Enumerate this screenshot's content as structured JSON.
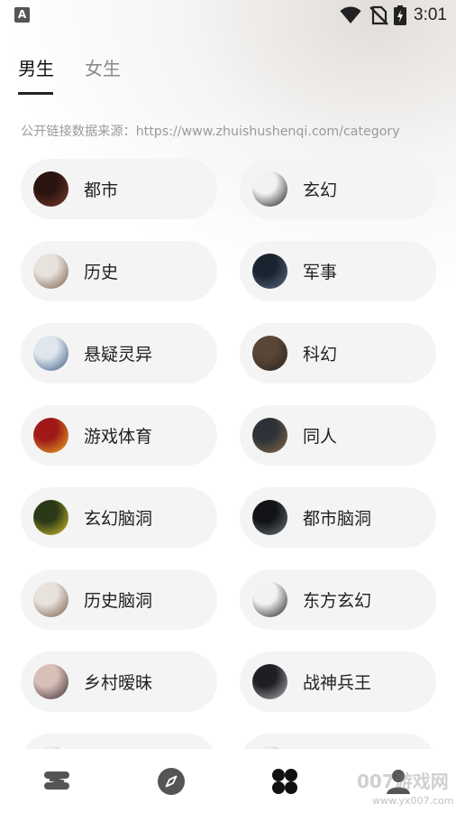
{
  "status_bar": {
    "app_icon_letter": "A",
    "time": "3:01",
    "icons": [
      "wifi-icon",
      "no-sim-icon",
      "battery-charging-icon"
    ]
  },
  "tabs": [
    {
      "label": "男生",
      "active": true
    },
    {
      "label": "女生",
      "active": false
    }
  ],
  "source_note": "公开链接数据来源：https://www.zhuishushenqi.com/category",
  "categories": [
    {
      "label": "都市",
      "cover_colors": [
        "#2a1410",
        "#7a3a2a"
      ]
    },
    {
      "label": "玄幻",
      "cover_colors": [
        "#f2f2f2",
        "#1a1a1a"
      ]
    },
    {
      "label": "历史",
      "cover_colors": [
        "#e8e2dc",
        "#7a5a44"
      ]
    },
    {
      "label": "军事",
      "cover_colors": [
        "#1a2430",
        "#5a6a80"
      ]
    },
    {
      "label": "悬疑灵异",
      "cover_colors": [
        "#dfe6ee",
        "#3a5a80"
      ]
    },
    {
      "label": "科幻",
      "cover_colors": [
        "#5a4636",
        "#2a2420"
      ]
    },
    {
      "label": "游戏体育",
      "cover_colors": [
        "#a01818",
        "#e8b020"
      ]
    },
    {
      "label": "同人",
      "cover_colors": [
        "#2c3238",
        "#8a6a48"
      ]
    },
    {
      "label": "玄幻脑洞",
      "cover_colors": [
        "#2a3a18",
        "#d8c028"
      ]
    },
    {
      "label": "都市脑洞",
      "cover_colors": [
        "#121418",
        "#6a7278"
      ]
    },
    {
      "label": "历史脑洞",
      "cover_colors": [
        "#e8e2dc",
        "#7a5a44"
      ]
    },
    {
      "label": "东方玄幻",
      "cover_colors": [
        "#f2f2f2",
        "#1a1a1a"
      ]
    },
    {
      "label": "乡村暧昧",
      "cover_colors": [
        "#d8c0b8",
        "#3a2a30"
      ]
    },
    {
      "label": "战神兵王",
      "cover_colors": [
        "#1e1e24",
        "#b0b0b8"
      ]
    },
    {
      "label": "",
      "cover_colors": [
        "#ececec",
        "#c02020"
      ]
    },
    {
      "label": "",
      "cover_colors": [
        "#ececec",
        "#222222"
      ]
    }
  ],
  "bottom_nav": [
    {
      "name": "nav-shelf",
      "icon": "bookshelf-icon",
      "active": false
    },
    {
      "name": "nav-discover",
      "icon": "compass-icon",
      "active": false
    },
    {
      "name": "nav-category",
      "icon": "category-grid-icon",
      "active": true
    },
    {
      "name": "nav-profile",
      "icon": "profile-icon",
      "active": false
    }
  ],
  "watermark": {
    "text": "007游戏网",
    "url": "www.yx007.com"
  },
  "colors": {
    "active_tab": "#111111",
    "inactive_tab": "#8a8a8a",
    "card_bg": "#f4f4f4",
    "note_text": "#9a9a9a",
    "nav_icon": "#555555",
    "nav_icon_active": "#111111"
  }
}
